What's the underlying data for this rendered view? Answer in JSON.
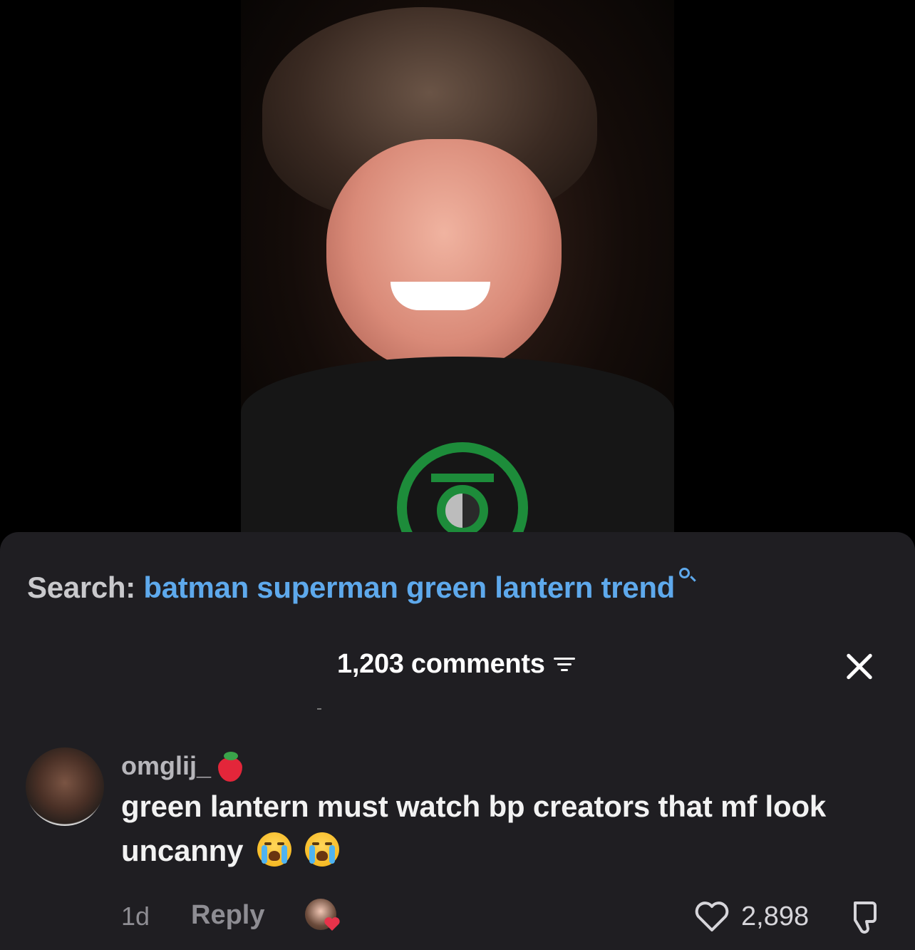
{
  "search": {
    "label": "Search:",
    "query": "batman superman green lantern trend"
  },
  "comments_panel": {
    "count_label": "1,203 comments"
  },
  "comment": {
    "username": "omglij_",
    "text": "green lantern must watch bp creators that mf look uncanny",
    "age": "1d",
    "reply_label": "Reply",
    "like_count": "2,898"
  },
  "colors": {
    "accent_blue": "#5ea9ec",
    "sheet_bg": "#1f1e22",
    "lantern_green": "#1d8c3a",
    "heart_red": "#e8334a"
  },
  "icons": [
    "search-icon",
    "sort-icon",
    "close-icon",
    "strawberry-emoji",
    "loudly-crying-face-emoji",
    "heart-icon",
    "thumbs-down-icon"
  ]
}
